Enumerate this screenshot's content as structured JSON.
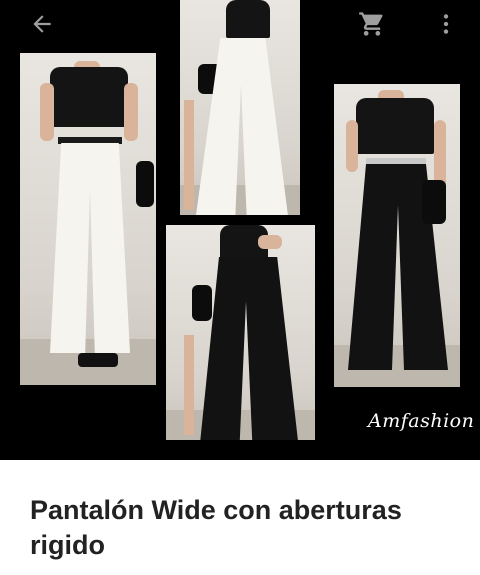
{
  "toolbar": {
    "back_icon": "back-arrow-icon",
    "cart_icon": "shopping-cart-icon",
    "more_icon": "more-vertical-icon"
  },
  "gallery": {
    "watermark": "Amfashion",
    "photos": [
      {
        "subject": "white-wide-pants-front"
      },
      {
        "subject": "white-wide-pants-back"
      },
      {
        "subject": "black-wide-pants-front"
      },
      {
        "subject": "black-wide-pants-back"
      }
    ]
  },
  "product": {
    "title": "Pantalón Wide con aberturas rigido"
  },
  "colors": {
    "hero_background": "#000000",
    "title_text": "#222222",
    "icon_color": "#9e9e9e"
  }
}
